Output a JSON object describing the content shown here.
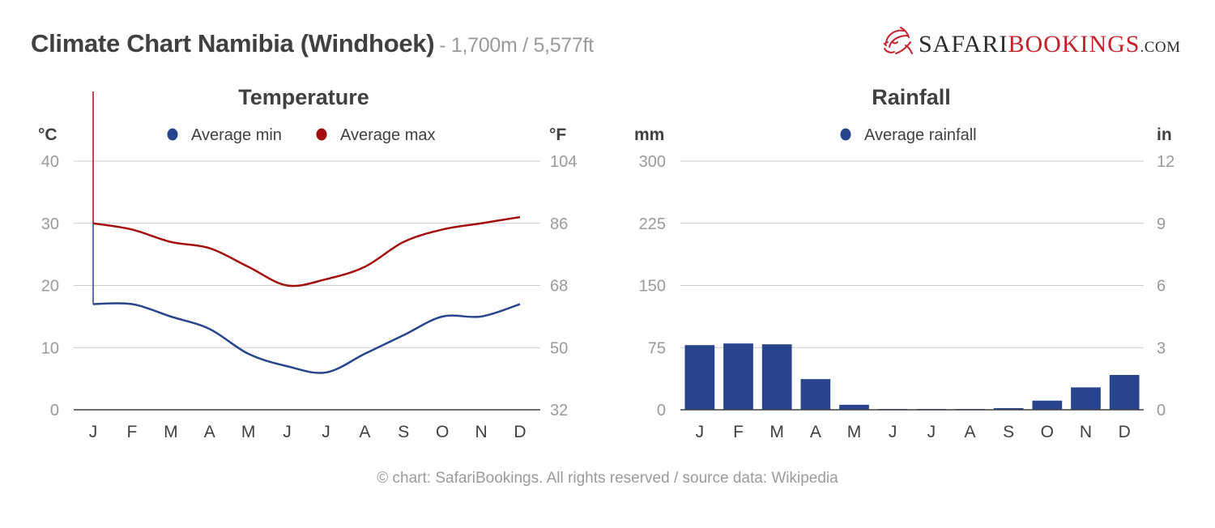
{
  "header": {
    "title": "Climate Chart Namibia (Windhoek)",
    "subtitle": "- 1,700m / 5,577ft"
  },
  "logo": {
    "icon": "lion-head-icon",
    "part1": "Safari",
    "part2": "Bookings",
    "part3": ".com",
    "color_primary": "#c4222b",
    "color_dark": "#2b2b2b"
  },
  "footer": {
    "text": "© chart: SafariBookings. All rights reserved / source data: Wikipedia"
  },
  "chart_data": [
    {
      "type": "line",
      "title": "Temperature",
      "categories": [
        "J",
        "F",
        "M",
        "A",
        "M",
        "J",
        "J",
        "A",
        "S",
        "O",
        "N",
        "D"
      ],
      "series": [
        {
          "name": "Average min",
          "color": "#27448c",
          "values": [
            17,
            17,
            15,
            13,
            9,
            7,
            6,
            9,
            12,
            15,
            15,
            17
          ]
        },
        {
          "name": "Average max",
          "color": "#a30e0e",
          "values": [
            30,
            29,
            27,
            26,
            23,
            20,
            21,
            23,
            27,
            29,
            30,
            31
          ]
        }
      ],
      "ylabel_left": "°C",
      "ylabel_right": "°F",
      "ylim": [
        0,
        40
      ],
      "yticks_left": [
        "0",
        "10",
        "20",
        "30",
        "40"
      ],
      "yticks_right": [
        "32",
        "50",
        "68",
        "86",
        "104"
      ],
      "grid": true,
      "legend": "top-center"
    },
    {
      "type": "bar",
      "title": "Rainfall",
      "categories": [
        "J",
        "F",
        "M",
        "A",
        "M",
        "J",
        "J",
        "A",
        "S",
        "O",
        "N",
        "D"
      ],
      "series": [
        {
          "name": "Average rainfall",
          "color": "#27448c",
          "values": [
            78,
            80,
            79,
            37,
            6,
            1,
            1,
            1,
            2,
            11,
            27,
            42
          ]
        }
      ],
      "ylabel_left": "mm",
      "ylabel_right": "in",
      "ylim": [
        0,
        300
      ],
      "yticks_left": [
        "0",
        "75",
        "150",
        "225",
        "300"
      ],
      "yticks_right": [
        "0",
        "3",
        "6",
        "9",
        "12"
      ],
      "grid": true,
      "legend": "top-center"
    }
  ]
}
